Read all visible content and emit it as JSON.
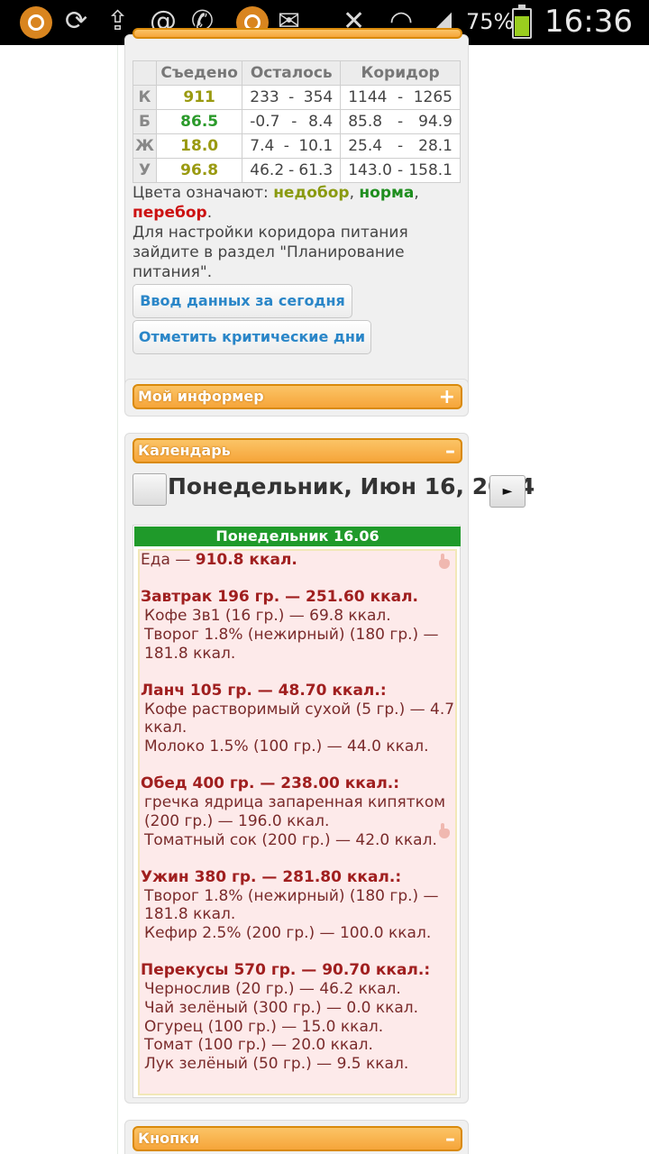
{
  "status_bar": {
    "icons": [
      "app-icon",
      "sync-icon",
      "upload-icon",
      "at-icon",
      "whatsapp-icon",
      "app-icon",
      "email-icon",
      "mute-icon",
      "wifi-icon",
      "signal-icon"
    ],
    "battery": "75%",
    "time": "16:36"
  },
  "nutrition": {
    "headers": [
      "Съедено",
      "Осталось",
      "Коридор"
    ],
    "rows": [
      {
        "label": "К",
        "eaten": "911",
        "left_from": "233",
        "left_to": "354",
        "corr_from": "1144",
        "corr_to": "1265"
      },
      {
        "label": "Б",
        "eaten": "86.5",
        "left_from": "-0.7",
        "left_to": "8.4",
        "corr_from": "85.8",
        "corr_to": "94.9"
      },
      {
        "label": "Ж",
        "eaten": "18.0",
        "left_from": "7.4",
        "left_to": "10.1",
        "corr_from": "25.4",
        "corr_to": "28.1"
      },
      {
        "label": "У",
        "eaten": "96.8",
        "left_from": "46.2",
        "left_to": "61.3",
        "corr_from": "143.0",
        "corr_to": "158.1"
      }
    ],
    "dash": "-",
    "legend_prefix": "Цвета означают: ",
    "legend_under": "недобор",
    "legend_comma1": ", ",
    "legend_norm": "норма",
    "legend_comma2": ",",
    "legend_over": "перебор",
    "legend_dot": ".",
    "note": "Для настройки коридора питания зайдите в раздел \"Планирование питания\".",
    "btn_enter": "Ввод данных за сегодня",
    "btn_critical": "Отметить критические дни"
  },
  "informer": {
    "title": "Мой информер",
    "toggle": "+"
  },
  "calendar": {
    "title": "Календарь",
    "toggle": "–",
    "date": "Понедельник, Июн 16, 2014",
    "next": "►",
    "day_header": "Понедельник 16.06",
    "food_total_prefix": "Еда — ",
    "food_total": "910.8 ккал.",
    "meals": [
      {
        "title": "Завтрак 196 гр. — 251.60 ккал.",
        "items": [
          "Кофе 3в1 (16 гр.) — 69.8 ккал.",
          "Творог 1.8% (нежирный) (180 гр.) — 181.8 ккал."
        ]
      },
      {
        "title": "Ланч 105 гр. — 48.70 ккал.:",
        "items": [
          "Кофе растворимый сухой (5 гр.) — 4.7 ккал.",
          "Молоко 1.5% (100 гр.) — 44.0 ккал."
        ]
      },
      {
        "title": "Обед 400 гр. — 238.00 ккал.:",
        "items": [
          "гречка ядрица запаренная кипятком (200 гр.) — 196.0 ккал.",
          "Томатный сок (200 гр.) — 42.0 ккал."
        ]
      },
      {
        "title": "Ужин 380 гр. — 281.80 ккал.:",
        "items": [
          "Творог 1.8% (нежирный) (180 гр.) — 181.8 ккал.",
          "Кефир 2.5% (200 гр.) — 100.0 ккал."
        ]
      },
      {
        "title": "Перекусы 570 гр. — 90.70 ккал.:",
        "items": [
          "Чернослив (20 гр.) — 46.2 ккал.",
          "Чай зелёный (300 гр.) — 0.0 ккал.",
          "Огурец (100 гр.) — 15.0 ккал.",
          "Томат (100 гр.) — 20.0 ккал.",
          "Лук зелёный (50 гр.) — 9.5 ккал."
        ]
      }
    ]
  },
  "buttons_panel": {
    "title": "Кнопки",
    "toggle": "–"
  }
}
